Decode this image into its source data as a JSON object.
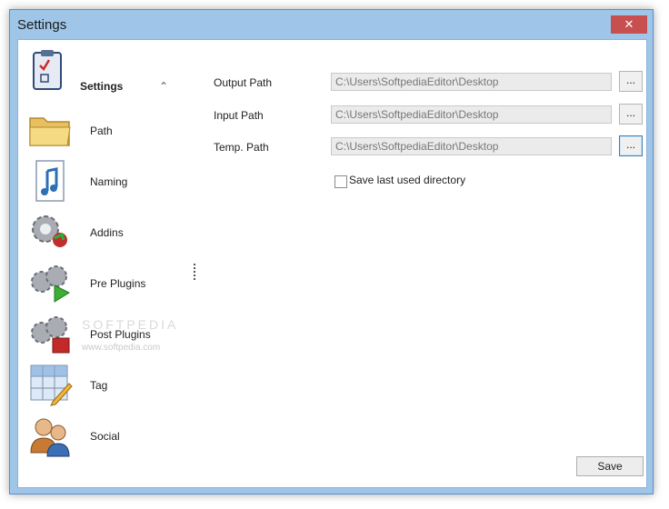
{
  "window": {
    "title": "Settings",
    "close_glyph": "✕"
  },
  "sidebar": {
    "header_label": "Settings",
    "header_icon": "clipboard-icon",
    "collapse_glyph": "⌃",
    "items": [
      {
        "label": "Path",
        "icon": "folder-icon"
      },
      {
        "label": "Naming",
        "icon": "music-note-icon"
      },
      {
        "label": "Addins",
        "icon": "gear-addin-icon"
      },
      {
        "label": "Pre Plugins",
        "icon": "gear-play-icon"
      },
      {
        "label": "Post Plugins",
        "icon": "gear-stop-icon"
      },
      {
        "label": "Tag",
        "icon": "tag-grid-pencil-icon"
      },
      {
        "label": "Social",
        "icon": "users-icon"
      }
    ]
  },
  "form": {
    "output_label": "Output Path",
    "output_value": "C:\\Users\\SoftpediaEditor\\Desktop",
    "input_label": "Input Path",
    "input_value": "C:\\Users\\SoftpediaEditor\\Desktop",
    "temp_label": "Temp. Path",
    "temp_value": "C:\\Users\\SoftpediaEditor\\Desktop",
    "browse_label": "...",
    "save_last_label": "Save last used directory",
    "save_last_checked": false
  },
  "footer": {
    "save_label": "Save"
  },
  "watermark": {
    "text": "SOFTPEDIA",
    "sub": "www.softpedia.com"
  },
  "colors": {
    "frame": "#9fc6e9",
    "close": "#c74f50"
  }
}
